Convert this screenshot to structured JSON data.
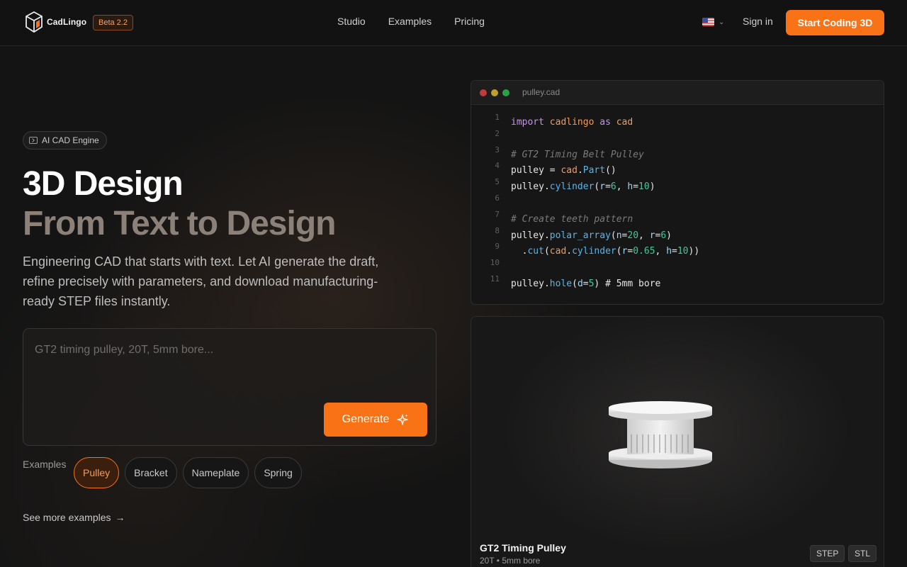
{
  "brand": {
    "name": "CadLingo",
    "beta": "Beta 2.2"
  },
  "nav": {
    "links": [
      "Studio",
      "Examples",
      "Pricing"
    ],
    "signin": "Sign in",
    "cta": "Start Coding 3D"
  },
  "hero": {
    "badge": "AI CAD Engine",
    "title_line1": "3D Design",
    "title_line2": "From Text to Design",
    "description": "Engineering CAD that starts with text. Let AI generate the draft, refine precisely with parameters, and download manufacturing-ready STEP files instantly.",
    "prompt_placeholder": "GT2 timing pulley, 20T, 5mm bore...",
    "generate_label": "Generate",
    "examples_label": "Examples",
    "examples": [
      "Pulley",
      "Bracket",
      "Nameplate",
      "Spring"
    ],
    "active_example": "Pulley",
    "more_link": "See more examples"
  },
  "code": {
    "filename": "pulley.cad",
    "line_numbers": [
      "1",
      "2",
      "3",
      "4",
      "5",
      "6",
      "7",
      "8",
      "9",
      "10",
      "11"
    ],
    "lines": [
      "import cadlingo as cad",
      "",
      "# GT2 Timing Belt Pulley",
      "pulley = cad.Part()",
      "pulley.cylinder(r=6, h=10)",
      "",
      "# Create teeth pattern",
      "pulley.polar_array(n=20, r=6)",
      "  .cut(cad.cylinder(r=0.65, h=10))",
      "",
      "pulley.hole(d=5) # 5mm bore"
    ]
  },
  "preview": {
    "title": "GT2 Timing Pulley",
    "subtitle": "20T • 5mm bore",
    "formats": [
      "STEP",
      "STL"
    ]
  },
  "colors": {
    "accent": "#f97316",
    "background": "#141414"
  }
}
